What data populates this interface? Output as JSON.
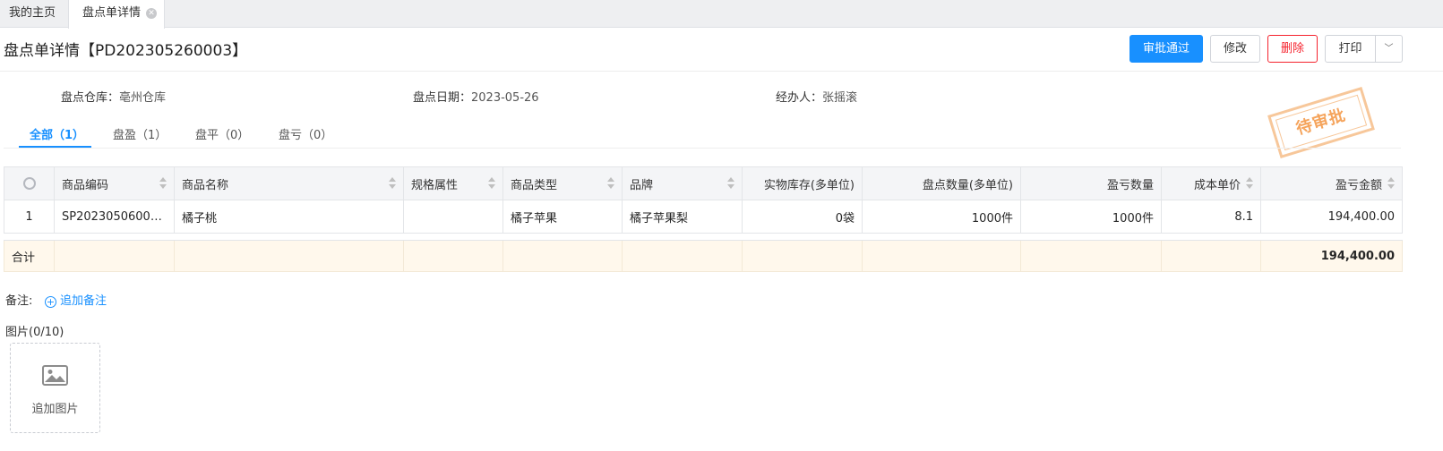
{
  "tabs": [
    {
      "label": "我的主页"
    },
    {
      "label": "盘点单详情"
    }
  ],
  "header": {
    "title": "盘点单详情【PD202305260003】",
    "buttons": {
      "approve": "审批通过",
      "edit": "修改",
      "delete": "删除",
      "print": "打印"
    }
  },
  "info": {
    "warehouse_label": "盘点仓库：",
    "warehouse_value": "亳州仓库",
    "date_label": "盘点日期：",
    "date_value": "2023-05-26",
    "handler_label": "经办人：",
    "handler_value": "张摇滚"
  },
  "stamp": "待审批",
  "filter_tabs": [
    {
      "label": "全部（1）",
      "active": true
    },
    {
      "label": "盘盈（1）"
    },
    {
      "label": "盘平（0）"
    },
    {
      "label": "盘亏（0）"
    }
  ],
  "table": {
    "columns": [
      "商品编码",
      "商品名称",
      "规格属性",
      "商品类型",
      "品牌",
      "实物库存(多单位)",
      "盘点数量(多单位)",
      "盈亏数量",
      "成本单价",
      "盈亏金额"
    ],
    "rows": [
      [
        "1",
        "SP20230506000...",
        "橘子桃",
        "",
        "橘子苹果",
        "橘子苹果梨",
        "0袋",
        "1000件",
        "1000件",
        "8.1",
        "194,400.00"
      ]
    ],
    "summary": {
      "label": "合计",
      "amount": "194,400.00"
    }
  },
  "remark": {
    "label": "备注:",
    "add": "追加备注"
  },
  "images": {
    "label": "图片(0/10)",
    "add": "追加图片"
  }
}
